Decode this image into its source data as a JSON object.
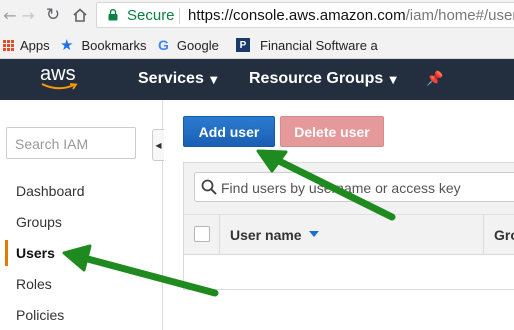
{
  "browser": {
    "security_label": "Secure",
    "url_host": "https://console.aws.amazon.com",
    "url_path": "/iam/home#/users",
    "bookmarks": [
      {
        "label": "Apps",
        "icon": "apps-grid-icon"
      },
      {
        "label": "Bookmarks",
        "icon": "star-icon"
      },
      {
        "label": "Google",
        "icon": "google-icon"
      },
      {
        "label": "Financial Software a",
        "icon": "p-favicon-icon"
      }
    ]
  },
  "aws_nav": {
    "logo_text": "aws",
    "menu": [
      "Services",
      "Resource Groups"
    ],
    "pin_icon": "pin-icon"
  },
  "sidebar": {
    "search_placeholder": "Search IAM",
    "items": [
      "Dashboard",
      "Groups",
      "Users",
      "Roles",
      "Policies"
    ],
    "active_item": "Users"
  },
  "main": {
    "add_user_label": "Add user",
    "delete_user_label": "Delete user",
    "find_placeholder": "Find users by username or access key",
    "columns": [
      "User name",
      "Gro"
    ]
  },
  "colors": {
    "aws_bar": "#232f3e",
    "primary_button": "#1a5fb4",
    "disabled_delete": "#e5999a",
    "active_accent": "#e07b00",
    "annotation_arrow": "#1f8a1f"
  }
}
